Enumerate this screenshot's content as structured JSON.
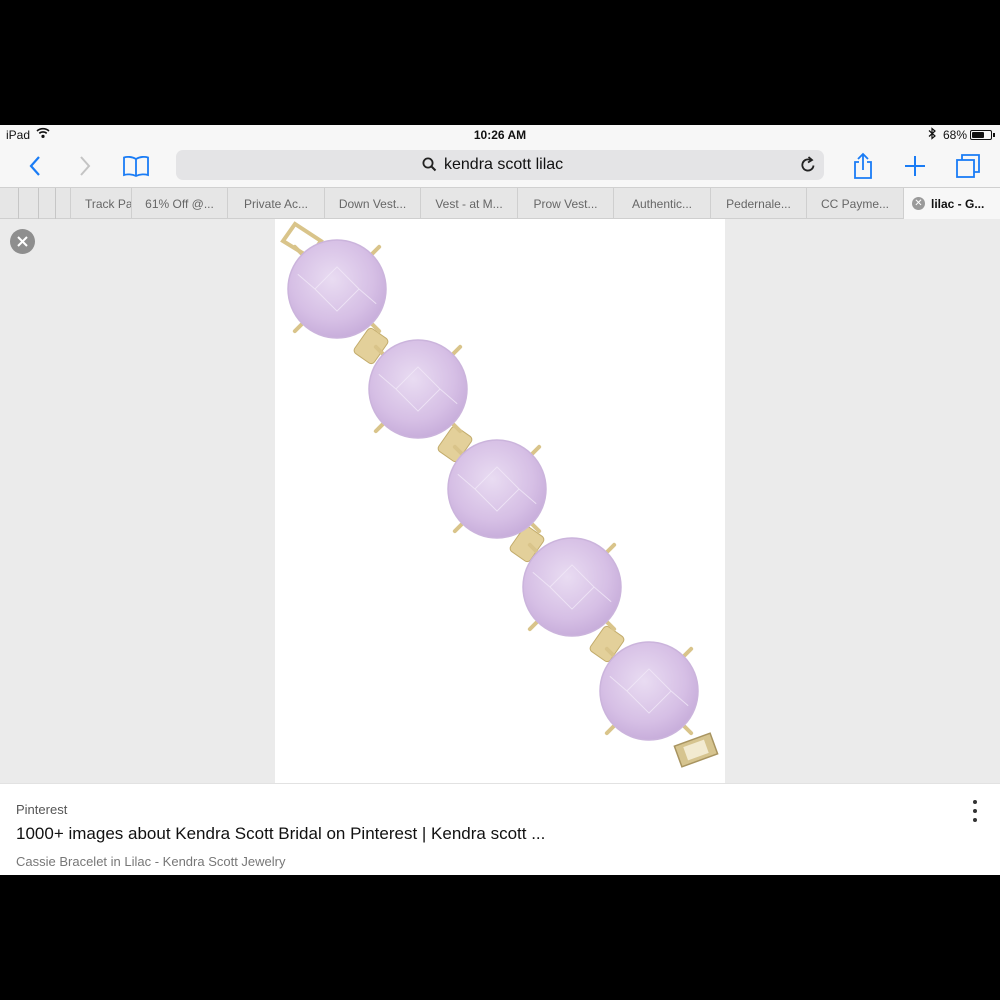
{
  "status_bar": {
    "device": "iPad",
    "time": "10:26 AM",
    "battery_percent": "68%",
    "battery_level": 0.68,
    "icons": [
      "wifi-icon",
      "bluetooth-icon",
      "battery-icon"
    ]
  },
  "toolbar": {
    "search_query": "kendra scott lilac",
    "icons": [
      "back-icon",
      "forward-icon",
      "bookmarks-icon",
      "search-icon",
      "reload-icon",
      "share-icon",
      "new-tab-icon",
      "tabs-icon"
    ],
    "accent_color": "#1a7cf5"
  },
  "tabs": [
    {
      "label": "Track Pa"
    },
    {
      "label": "61% Off @..."
    },
    {
      "label": "Private Ac..."
    },
    {
      "label": "Down Vest..."
    },
    {
      "label": "Vest - at M..."
    },
    {
      "label": "Prow Vest..."
    },
    {
      "label": "Authentic..."
    },
    {
      "label": "Pedernale..."
    },
    {
      "label": "CC Payme..."
    },
    {
      "label": "lilac - G...",
      "active": true
    }
  ],
  "viewer": {
    "close_icon": "close-icon",
    "image_subject": "lilac stone bracelet",
    "stone_color": "#d8c2e6",
    "metal_color": "#d9c48a"
  },
  "result": {
    "source": "Pinterest",
    "title": "1000+ images about Kendra Scott Bridal on Pinterest | Kendra scott ...",
    "subtitle": "Cassie Bracelet in Lilac - Kendra Scott Jewelry",
    "more_icon": "more-vertical-icon"
  }
}
